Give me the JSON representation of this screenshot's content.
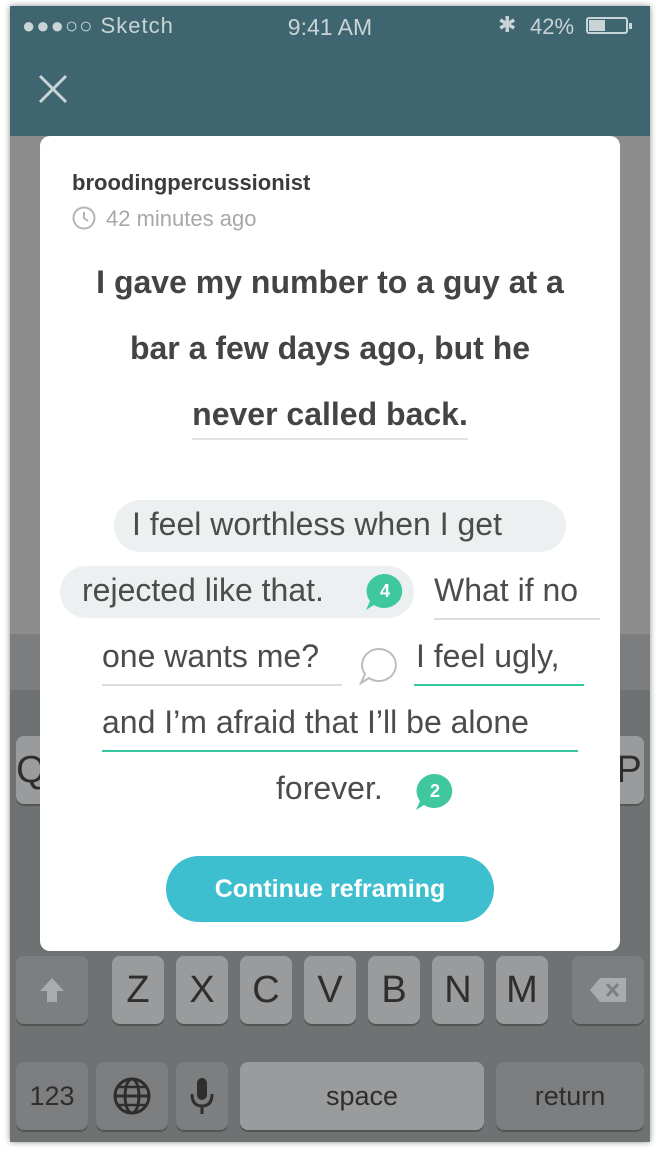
{
  "status_bar": {
    "carrier": "●●●○○ Sketch",
    "time": "9:41 AM",
    "battery": "42%",
    "battery_level": 0.42
  },
  "nav": {
    "close_icon": "close-icon"
  },
  "post": {
    "username": "broodingpercussionist",
    "time_ago": "42 minutes ago",
    "question_lines": [
      "I gave my number to a guy at a",
      "bar a few days ago, but he",
      "never called back."
    ],
    "thoughts": {
      "t1_line1": "I feel worthless when I get",
      "t1_line2": "rejected like that.",
      "t1_count": "4",
      "t2_part1": "What if no",
      "t2_part2": "one wants me?",
      "t3_part1": "I feel ugly,",
      "t3_part2": "and I’m afraid that I’ll be alone",
      "t3_part3": "forever.",
      "t3_count": "2"
    },
    "continue_button": "Continue reframing"
  },
  "keyboard": {
    "row3": [
      "Z",
      "X",
      "C",
      "V",
      "B",
      "N",
      "M"
    ],
    "numbers_key": "123",
    "space_key": "space",
    "return_key": "return",
    "left_partial": "Q",
    "right_partial": "P"
  },
  "colors": {
    "nav_bg": "#3f6670",
    "accent": "#3ebfcf",
    "teal_badge": "#3fc79e"
  }
}
